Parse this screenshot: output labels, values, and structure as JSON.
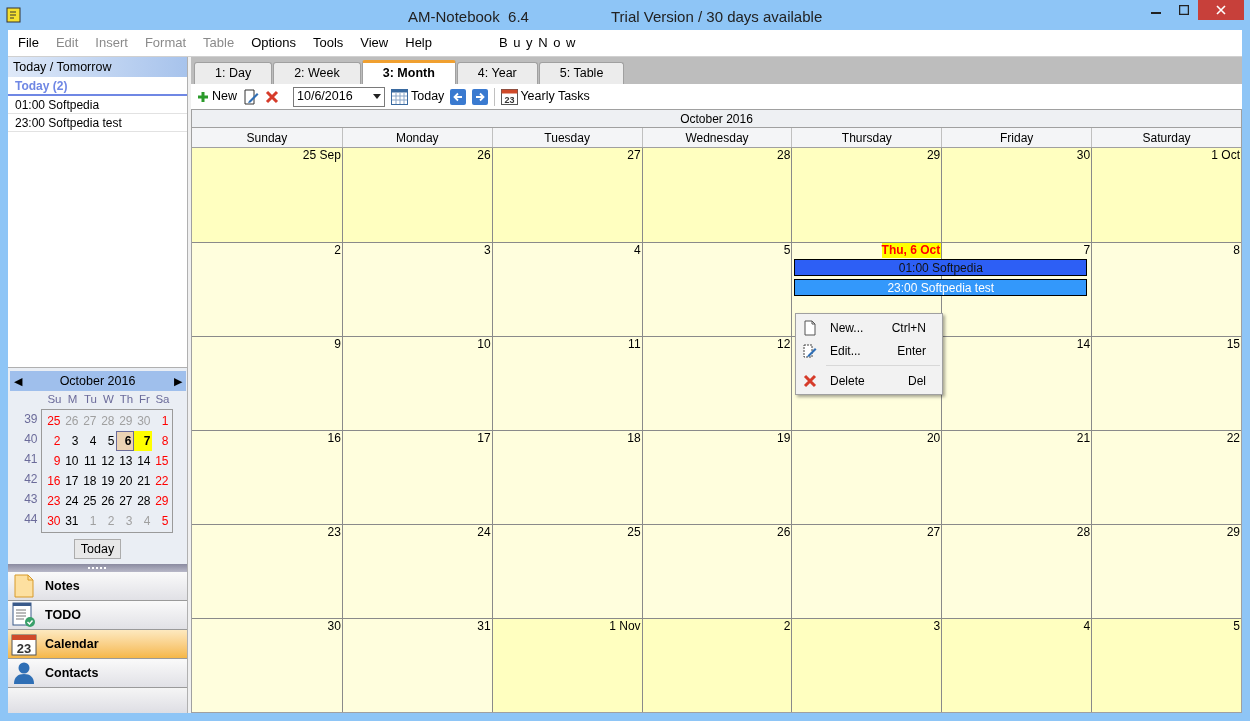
{
  "window": {
    "title": "AM-Notebook  6.4",
    "subtitle": "Trial Version / 30 days available"
  },
  "menu": [
    {
      "label": "File",
      "disabled": false
    },
    {
      "label": "Edit",
      "disabled": true
    },
    {
      "label": "Insert",
      "disabled": true
    },
    {
      "label": "Format",
      "disabled": true
    },
    {
      "label": "Table",
      "disabled": true
    },
    {
      "label": "Options",
      "disabled": false
    },
    {
      "label": "Tools",
      "disabled": false
    },
    {
      "label": "View",
      "disabled": false
    },
    {
      "label": "Help",
      "disabled": false
    }
  ],
  "buy_now": "B u y   N o w",
  "today_panel": {
    "title": "Today / Tomorrow",
    "group": "Today (2)",
    "items": [
      "01:00 Softpedia",
      "23:00 Softpedia test"
    ]
  },
  "mini_calendar": {
    "title": "October 2016",
    "prev": "◀",
    "next": "▶",
    "weekdays": [
      "Su",
      "M",
      "Tu",
      "W",
      "Th",
      "Fr",
      "Sa"
    ],
    "today_button": "Today",
    "weeks": [
      {
        "number": "39",
        "days": [
          {
            "d": "25",
            "kind": "weekend",
            "selected": false
          },
          {
            "d": "26",
            "kind": "adjacent",
            "selected": false
          },
          {
            "d": "27",
            "kind": "adjacent",
            "selected": false
          },
          {
            "d": "28",
            "kind": "adjacent",
            "selected": false
          },
          {
            "d": "29",
            "kind": "adjacent",
            "selected": false
          },
          {
            "d": "30",
            "kind": "adjacent",
            "selected": false
          },
          {
            "d": "1",
            "kind": "weekend",
            "selected": false
          }
        ]
      },
      {
        "number": "40",
        "days": [
          {
            "d": "2",
            "kind": "weekend",
            "selected": false
          },
          {
            "d": "3",
            "kind": "weekday",
            "selected": false
          },
          {
            "d": "4",
            "kind": "weekday",
            "selected": false
          },
          {
            "d": "5",
            "kind": "weekday",
            "selected": false
          },
          {
            "d": "6",
            "kind": "weekday",
            "selected": true
          },
          {
            "d": "7",
            "kind": "marked",
            "selected": false
          },
          {
            "d": "8",
            "kind": "weekend",
            "selected": false
          }
        ]
      },
      {
        "number": "41",
        "days": [
          {
            "d": "9",
            "kind": "weekend",
            "selected": false
          },
          {
            "d": "10",
            "kind": "weekday",
            "selected": false
          },
          {
            "d": "11",
            "kind": "weekday",
            "selected": false
          },
          {
            "d": "12",
            "kind": "weekday",
            "selected": false
          },
          {
            "d": "13",
            "kind": "weekday",
            "selected": false
          },
          {
            "d": "14",
            "kind": "weekday",
            "selected": false
          },
          {
            "d": "15",
            "kind": "weekend",
            "selected": false
          }
        ]
      },
      {
        "number": "42",
        "days": [
          {
            "d": "16",
            "kind": "weekend",
            "selected": false
          },
          {
            "d": "17",
            "kind": "weekday",
            "selected": false
          },
          {
            "d": "18",
            "kind": "weekday",
            "selected": false
          },
          {
            "d": "19",
            "kind": "weekday",
            "selected": false
          },
          {
            "d": "20",
            "kind": "weekday",
            "selected": false
          },
          {
            "d": "21",
            "kind": "weekday",
            "selected": false
          },
          {
            "d": "22",
            "kind": "weekend",
            "selected": false
          }
        ]
      },
      {
        "number": "43",
        "days": [
          {
            "d": "23",
            "kind": "weekend",
            "selected": false
          },
          {
            "d": "24",
            "kind": "weekday",
            "selected": false
          },
          {
            "d": "25",
            "kind": "weekday",
            "selected": false
          },
          {
            "d": "26",
            "kind": "weekday",
            "selected": false
          },
          {
            "d": "27",
            "kind": "weekday",
            "selected": false
          },
          {
            "d": "28",
            "kind": "weekday",
            "selected": false
          },
          {
            "d": "29",
            "kind": "weekend",
            "selected": false
          }
        ]
      },
      {
        "number": "44",
        "days": [
          {
            "d": "30",
            "kind": "weekend",
            "selected": false
          },
          {
            "d": "31",
            "kind": "weekday",
            "selected": false
          },
          {
            "d": "1",
            "kind": "adjacent",
            "selected": false
          },
          {
            "d": "2",
            "kind": "adjacent",
            "selected": false
          },
          {
            "d": "3",
            "kind": "adjacent",
            "selected": false
          },
          {
            "d": "4",
            "kind": "adjacent",
            "selected": false
          },
          {
            "d": "5",
            "kind": "weekend",
            "selected": false
          }
        ]
      }
    ]
  },
  "nav": [
    {
      "label": "Notes",
      "kind": "notes",
      "selected": false
    },
    {
      "label": "TODO",
      "kind": "todo",
      "selected": false
    },
    {
      "label": "Calendar",
      "kind": "calendar",
      "icon_text": "23",
      "selected": true
    },
    {
      "label": "Contacts",
      "kind": "contacts",
      "selected": false
    }
  ],
  "tabs": [
    {
      "label": "1: Day",
      "selected": false
    },
    {
      "label": "2: Week",
      "selected": false
    },
    {
      "label": "3: Month",
      "selected": true
    },
    {
      "label": "4: Year",
      "selected": false
    },
    {
      "label": "5: Table",
      "selected": false
    }
  ],
  "toolbar": {
    "new": "New",
    "date": "10/6/2016",
    "today": "Today",
    "yearly_tasks": "Yearly Tasks",
    "yearly_icon_text": "23"
  },
  "month": {
    "title": "October 2016",
    "weekdays": [
      "Sunday",
      "Monday",
      "Tuesday",
      "Wednesday",
      "Thursday",
      "Friday",
      "Saturday"
    ],
    "weeks": [
      [
        {
          "label": "25 Sep",
          "shaded": true,
          "today": false
        },
        {
          "label": "26",
          "shaded": true,
          "today": false
        },
        {
          "label": "27",
          "shaded": true,
          "today": false
        },
        {
          "label": "28",
          "shaded": true,
          "today": false
        },
        {
          "label": "29",
          "shaded": true,
          "today": false
        },
        {
          "label": "30",
          "shaded": true,
          "today": false
        },
        {
          "label": "1 Oct",
          "shaded": true,
          "today": false
        }
      ],
      [
        {
          "label": "2",
          "shaded": false,
          "today": false
        },
        {
          "label": "3",
          "shaded": false,
          "today": false
        },
        {
          "label": "4",
          "shaded": false,
          "today": false
        },
        {
          "label": "5",
          "shaded": false,
          "today": false
        },
        {
          "label": "Thu, 6 Oct",
          "shaded": false,
          "today": true,
          "events": [
            {
              "text": "01:00 Softpedia",
              "color": "#2d5ff5",
              "selected": true
            },
            {
              "text": "23:00 Softpedia test",
              "color": "#3398fb",
              "selected": false
            }
          ]
        },
        {
          "label": "7",
          "shaded": false,
          "today": false
        },
        {
          "label": "8",
          "shaded": false,
          "today": false
        }
      ],
      [
        {
          "label": "9",
          "shaded": false,
          "today": false
        },
        {
          "label": "10",
          "shaded": false,
          "today": false
        },
        {
          "label": "11",
          "shaded": false,
          "today": false
        },
        {
          "label": "12",
          "shaded": false,
          "today": false
        },
        {
          "shaded": false
        },
        {
          "label": "14",
          "shaded": false,
          "today": false
        },
        {
          "label": "15",
          "shaded": false,
          "today": false
        }
      ],
      [
        {
          "label": "16",
          "shaded": false,
          "today": false
        },
        {
          "label": "17",
          "shaded": false,
          "today": false
        },
        {
          "label": "18",
          "shaded": false,
          "today": false
        },
        {
          "label": "19",
          "shaded": false,
          "today": false
        },
        {
          "label": "20",
          "shaded": false,
          "today": false
        },
        {
          "label": "21",
          "shaded": false,
          "today": false
        },
        {
          "label": "22",
          "shaded": false,
          "today": false
        }
      ],
      [
        {
          "label": "23",
          "shaded": false,
          "today": false
        },
        {
          "label": "24",
          "shaded": false,
          "today": false
        },
        {
          "label": "25",
          "shaded": false,
          "today": false
        },
        {
          "label": "26",
          "shaded": false,
          "today": false
        },
        {
          "label": "27",
          "shaded": false,
          "today": false
        },
        {
          "label": "28",
          "shaded": false,
          "today": false
        },
        {
          "label": "29",
          "shaded": false,
          "today": false
        }
      ],
      [
        {
          "label": "30",
          "shaded": false,
          "today": false
        },
        {
          "label": "31",
          "shaded": false,
          "today": false
        },
        {
          "label": "1 Nov",
          "shaded": true,
          "today": false
        },
        {
          "label": "2",
          "shaded": true,
          "today": false
        },
        {
          "label": "3",
          "shaded": true,
          "today": false
        },
        {
          "label": "4",
          "shaded": true,
          "today": false
        },
        {
          "label": "5",
          "shaded": true,
          "today": false
        }
      ]
    ]
  },
  "context_menu": [
    {
      "kind": "new",
      "label": "New...",
      "shortcut": "Ctrl+N"
    },
    {
      "kind": "edit",
      "label": "Edit...",
      "shortcut": "Enter"
    },
    {
      "kind": "delete",
      "label": "Delete",
      "shortcut": "Del"
    }
  ]
}
